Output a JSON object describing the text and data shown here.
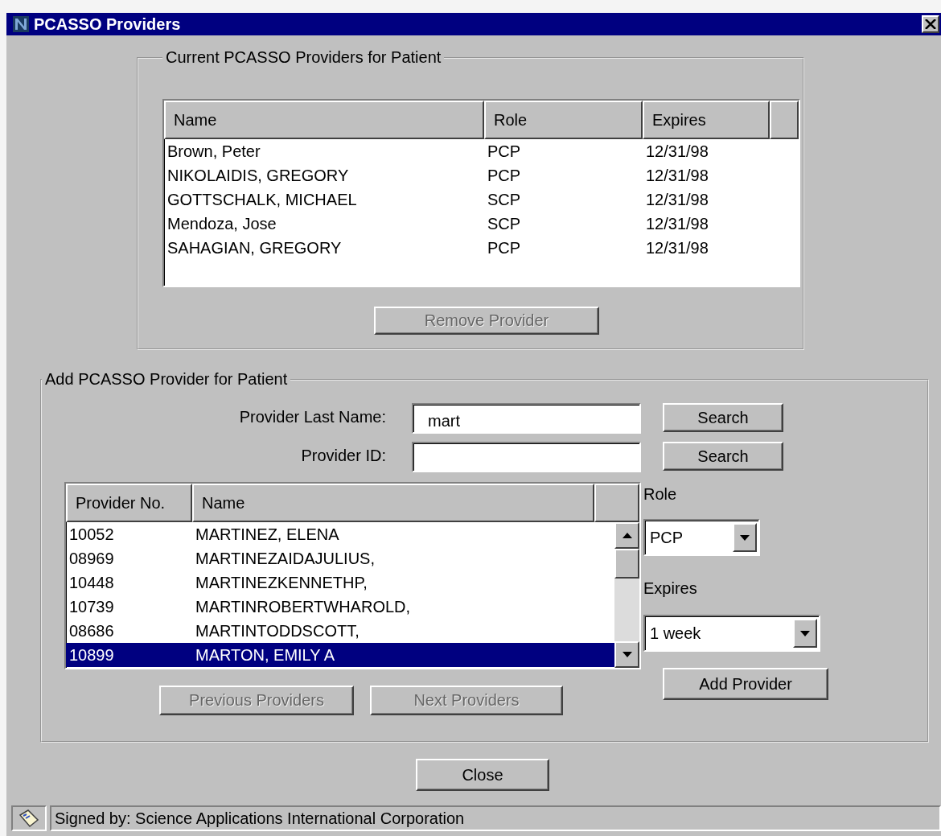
{
  "window": {
    "title": "PCASSO Providers"
  },
  "current_providers": {
    "title": "Current PCASSO Providers for Patient",
    "columns": [
      "Name",
      "Role",
      "Expires"
    ],
    "rows": [
      {
        "name": "Brown, Peter",
        "role": "PCP",
        "expires": "12/31/98"
      },
      {
        "name": "NIKOLAIDIS, GREGORY",
        "role": "PCP",
        "expires": "12/31/98"
      },
      {
        "name": "GOTTSCHALK, MICHAEL",
        "role": "SCP",
        "expires": "12/31/98"
      },
      {
        "name": "Mendoza, Jose",
        "role": "SCP",
        "expires": "12/31/98"
      },
      {
        "name": "SAHAGIAN, GREGORY",
        "role": "PCP",
        "expires": "12/31/98"
      }
    ],
    "remove_button": {
      "label": "Remove Provider",
      "disabled": true
    }
  },
  "add_provider": {
    "title": "Add PCASSO Provider for Patient",
    "fields": [
      {
        "label": "Provider Last Name:",
        "value": "mart",
        "button": "Search"
      },
      {
        "label": "Provider ID:",
        "button": "Search"
      }
    ],
    "results": {
      "columns": [
        "Provider No.",
        "Name"
      ],
      "rows": [
        {
          "provider_no": "10052",
          "name": "MARTINEZ, ELENA",
          "selected": false
        },
        {
          "provider_no": "08969",
          "name": "MARTINEZAIDAJULIUS,",
          "selected": false
        },
        {
          "provider_no": "10448",
          "name": "MARTINEZKENNETHP,",
          "selected": false
        },
        {
          "provider_no": "10739",
          "name": "MARTINROBERTWHAROLD,",
          "selected": false
        },
        {
          "provider_no": "08686",
          "name": "MARTINTODDSCOTT,",
          "selected": false
        },
        {
          "provider_no": "10899",
          "name": "MARTON, EMILY A",
          "selected": true
        }
      ]
    },
    "previous_button": {
      "label": "Previous Providers",
      "disabled": true
    },
    "next_button": {
      "label": "Next Providers",
      "disabled": true
    },
    "role": {
      "label": "Role",
      "value": "PCP"
    },
    "expires": {
      "label": "Expires",
      "value": "1 week"
    },
    "add_button": {
      "label": "Add Provider",
      "disabled": false
    }
  },
  "close_button": {
    "label": "Close"
  },
  "status_bar": {
    "text": "Signed by: Science Applications International Corporation"
  }
}
